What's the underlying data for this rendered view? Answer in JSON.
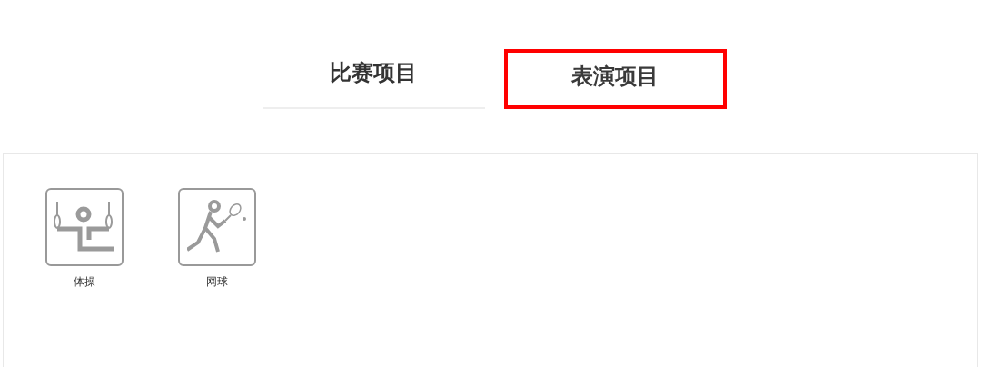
{
  "tabs": [
    {
      "label": "比赛项目",
      "selected": true,
      "highlighted": false
    },
    {
      "label": "表演项目",
      "selected": false,
      "highlighted": true
    }
  ],
  "sports": [
    {
      "kind": "gymnastics",
      "label": "体操"
    },
    {
      "kind": "tennis",
      "label": "网球"
    }
  ]
}
